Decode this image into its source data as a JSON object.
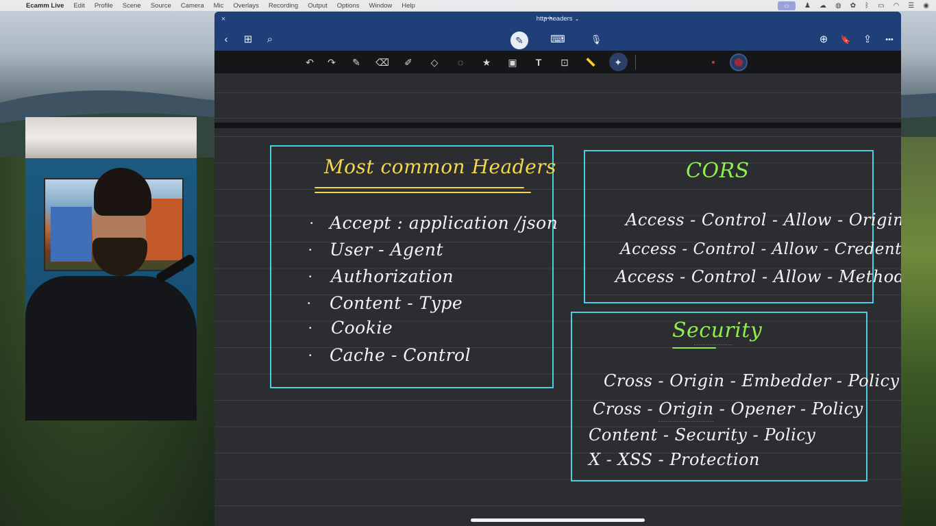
{
  "menubar": {
    "app_name": "Ecamm Live",
    "items": [
      "Edit",
      "Profile",
      "Scene",
      "Source",
      "Camera",
      "Mic",
      "Overlays",
      "Recording",
      "Output",
      "Options",
      "Window",
      "Help"
    ]
  },
  "window": {
    "title": "http headers",
    "close_glyph": "×",
    "caret_glyph": "⌄",
    "more_glyph": "•••"
  },
  "navbar": {
    "back": "‹",
    "grid": "⊞",
    "search": "⌕",
    "pen": "✎",
    "keyboard": "⌨",
    "mic": "🎙",
    "add_page": "⊕",
    "bookmark": "🔖",
    "share": "⇪",
    "more": "•••"
  },
  "toolbar": {
    "undo": "↶",
    "redo": "↷",
    "pen": "✎",
    "eraser": "⌫",
    "highlighter": "✐",
    "shapes": "◇",
    "lasso": "◌",
    "stickers": "★",
    "image": "▣",
    "text": "T",
    "scan": "⊡",
    "ruler": "📏",
    "laser": "✦"
  },
  "notes": {
    "headers_title": "Most common Headers",
    "headers": [
      "Accept : application /json",
      "User - Agent",
      "Authorization",
      "Content - Type",
      "Cookie",
      "Cache - Control"
    ],
    "cors_title": "CORS",
    "cors": [
      "Access - Control - Allow - Origin",
      "Access - Control - Allow - Credentials",
      "Access - Control - Allow - Method"
    ],
    "security_title": "Security",
    "security": [
      "Cross - Origin - Embedder - Policy",
      "Cross - Origin - Opener - Policy",
      "Content - Security - Policy",
      "X - XSS - Protection"
    ]
  },
  "colors": {
    "titlebar": "#1f3f78",
    "box_border": "#4ad0e3",
    "ink_yellow": "#f2d84a",
    "ink_green": "#8ef04a",
    "ink_white": "#f4f4f4"
  }
}
